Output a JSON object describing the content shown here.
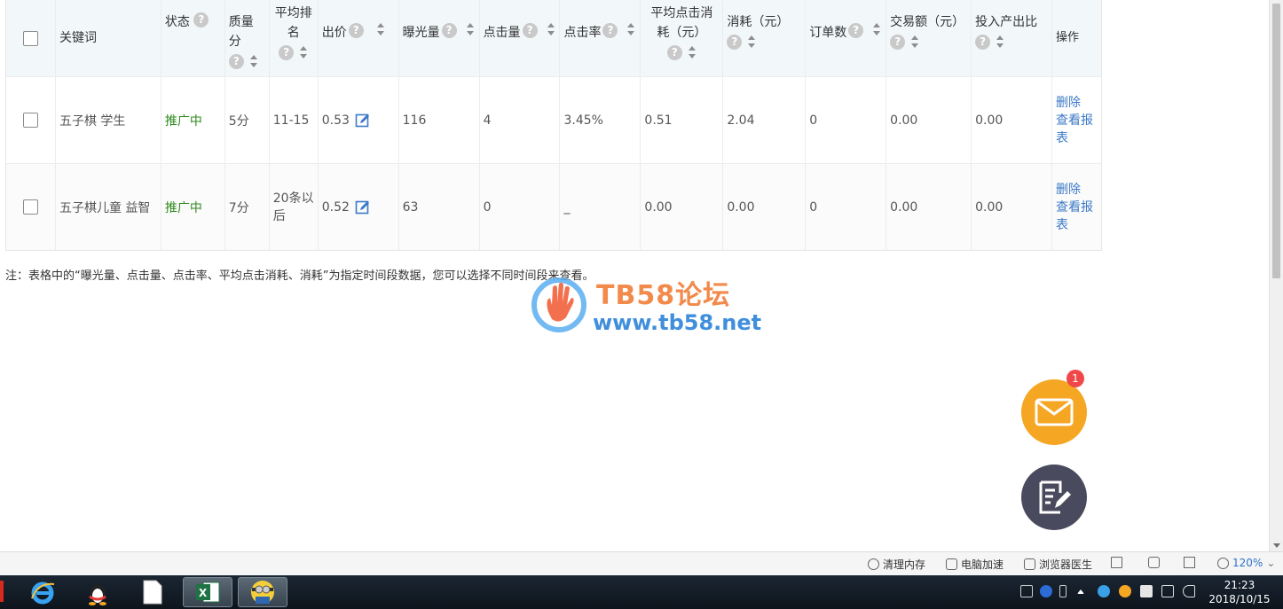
{
  "table": {
    "headers": {
      "keyword": "关键词",
      "status": "状态",
      "quality": "质量分",
      "avg_rank": "平均排名",
      "bid": "出价",
      "impressions": "曝光量",
      "clicks": "点击量",
      "ctr": "点击率",
      "avg_cpc": "平均点击消耗（元）",
      "cost": "消耗（元）",
      "orders": "订单数",
      "gmv": "交易额（元）",
      "roi": "投入产出比",
      "ops": "操作"
    },
    "rows": [
      {
        "keyword": "五子棋 学生",
        "status": "推广中",
        "quality": "5分",
        "avg_rank": "11-15",
        "bid": "0.53",
        "impressions": "116",
        "clicks": "4",
        "ctr": "3.45%",
        "avg_cpc": "0.51",
        "cost": "2.04",
        "orders": "0",
        "gmv": "0.00",
        "roi": "0.00",
        "op_delete": "删除",
        "op_report": "查看报表"
      },
      {
        "keyword": "五子棋儿童 益智",
        "status": "推广中",
        "quality": "7分",
        "avg_rank": "20条以后",
        "bid": "0.52",
        "impressions": "63",
        "clicks": "0",
        "ctr": "_",
        "avg_cpc": "0.00",
        "cost": "0.00",
        "orders": "0",
        "gmv": "0.00",
        "roi": "0.00",
        "op_delete": "删除",
        "op_report": "查看报表"
      }
    ]
  },
  "note": "注：表格中的“曝光量、点击量、点击率、平均点击消耗、消耗”为指定时间段数据，您可以选择不同时间段来查看。",
  "watermark": {
    "brand": "TB58论坛",
    "url": "www.tb58.net"
  },
  "fab": {
    "mail_badge": "1"
  },
  "statusbar": {
    "clear_memory": "清理内存",
    "pc_speed": "电脑加速",
    "browser_doctor": "浏览器医生",
    "zoom": "120%"
  },
  "taskbar": {
    "time": "21:23",
    "date": "2018/10/15"
  },
  "colors": {
    "status_green": "#2f8a1c",
    "link_blue": "#3b79c6",
    "fab_orange": "#f5a623",
    "fab_dark": "#4a4a5e",
    "badge_red": "#f04848"
  }
}
